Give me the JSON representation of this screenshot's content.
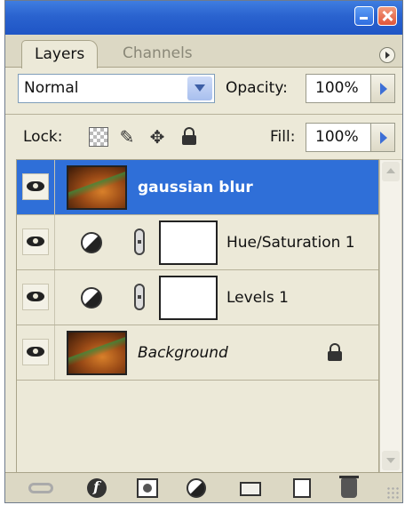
{
  "tabs": {
    "layers": "Layers",
    "channels": "Channels"
  },
  "options": {
    "blend_mode": "Normal",
    "opacity_label": "Opacity:",
    "opacity_value": "100%",
    "lock_label": "Lock:",
    "fill_label": "Fill:",
    "fill_value": "100%"
  },
  "layers": [
    {
      "name": "gaussian blur",
      "selected": true,
      "type": "pixel"
    },
    {
      "name": "Hue/Saturation 1",
      "selected": false,
      "type": "adjustment"
    },
    {
      "name": "Levels 1",
      "selected": false,
      "type": "adjustment"
    },
    {
      "name": "Background",
      "selected": false,
      "type": "background",
      "locked": true
    }
  ],
  "colors": {
    "selection": "#2f6fd8",
    "panel_bg": "#ece9d8",
    "titlebar": "#2a63cf"
  },
  "icons": {
    "minimize": "minimize-icon",
    "close": "close-icon",
    "visibility": "eye-icon",
    "lock": "lock-icon",
    "link": "chain-link-icon",
    "fx": "layer-style-icon",
    "mask": "add-mask-icon",
    "adjustment": "adjustment-layer-icon",
    "group": "folder-icon",
    "new_layer": "new-layer-icon",
    "delete": "trash-icon"
  }
}
